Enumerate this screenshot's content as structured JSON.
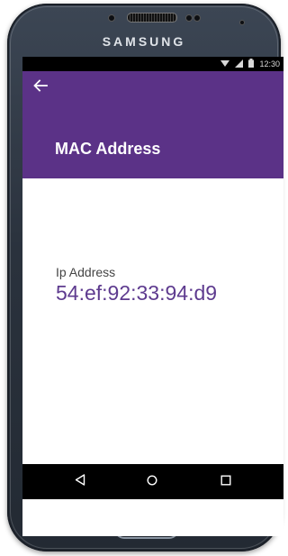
{
  "device": {
    "brand": "SAMSUNG"
  },
  "status_bar": {
    "time": "12:30",
    "icons": [
      "wifi-icon",
      "signal-icon",
      "battery-icon"
    ]
  },
  "app_bar": {
    "back_icon": "arrow-left-icon",
    "title": "MAC Address",
    "color": "#5b3287"
  },
  "content": {
    "label": "Ip Address",
    "value": "54:ef:92:33:94:d9",
    "value_color": "#5e3b8f"
  },
  "nav_bar": {
    "buttons": [
      "back-triangle-icon",
      "home-circle-icon",
      "recents-square-icon"
    ]
  }
}
